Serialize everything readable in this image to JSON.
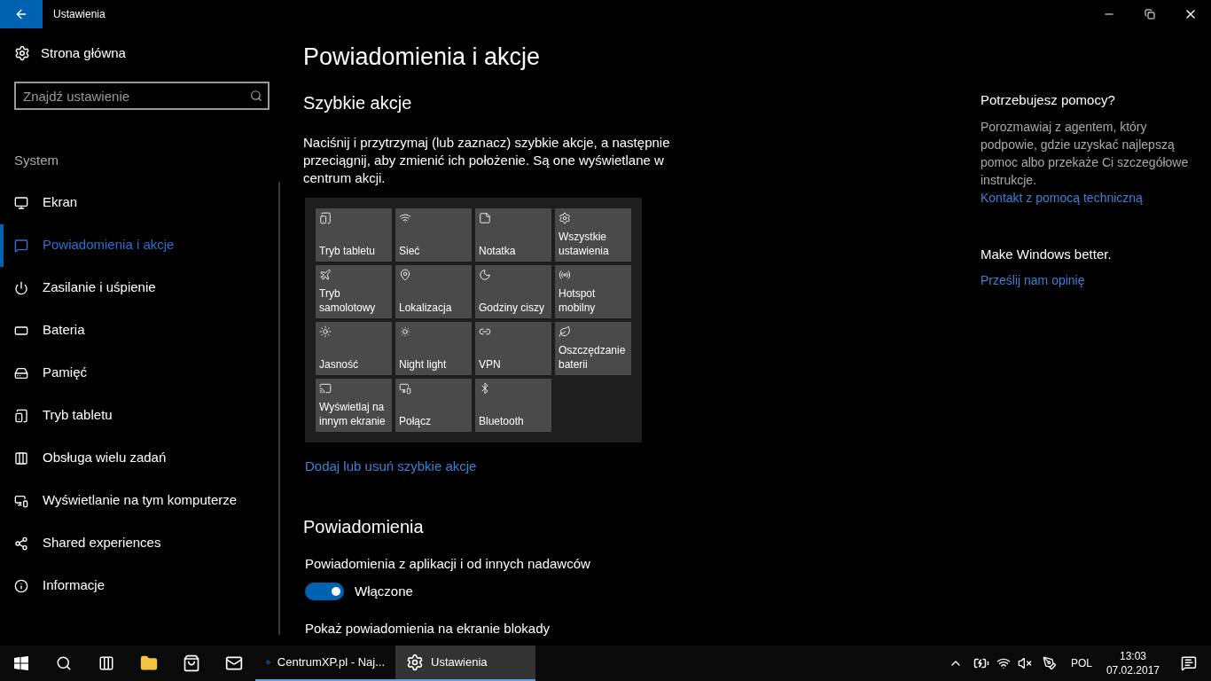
{
  "window": {
    "title": "Ustawienia"
  },
  "sidebar": {
    "home": "Strona główna",
    "search": {
      "placeholder": "Znajdź ustawienie"
    },
    "section": "System",
    "items": [
      {
        "label": "Ekran",
        "selected": false
      },
      {
        "label": "Powiadomienia i akcje",
        "selected": true
      },
      {
        "label": "Zasilanie i uśpienie",
        "selected": false
      },
      {
        "label": "Bateria",
        "selected": false
      },
      {
        "label": "Pamięć",
        "selected": false
      },
      {
        "label": "Tryb tabletu",
        "selected": false
      },
      {
        "label": "Obsługa wielu zadań",
        "selected": false
      },
      {
        "label": "Wyświetlanie na tym komputerze",
        "selected": false
      },
      {
        "label": "Shared experiences",
        "selected": false
      },
      {
        "label": "Informacje",
        "selected": false
      }
    ]
  },
  "main": {
    "title": "Powiadomienia i akcje",
    "quick_actions": {
      "heading": "Szybkie akcje",
      "description": "Naciśnij i przytrzymaj (lub zaznacz) szybkie akcje, a następnie przeciągnij, aby zmienić ich położenie. Są one wyświetlane w centrum akcji.",
      "tiles": [
        "Tryb tabletu",
        "Sieć",
        "Notatka",
        "Wszystkie ustawienia",
        "Tryb samolotowy",
        "Lokalizacja",
        "Godziny ciszy",
        "Hotspot mobilny",
        "Jasność",
        "Night light",
        "VPN",
        "Oszczędzanie baterii",
        "Wyświetlaj na innym ekranie",
        "Połącz",
        "Bluetooth"
      ],
      "link": "Dodaj lub usuń szybkie akcje"
    },
    "notifications": {
      "heading": "Powiadomienia",
      "settings": [
        {
          "label": "Powiadomienia z aplikacji i od innych nadawców",
          "on": true,
          "state": "Włączone"
        }
      ],
      "next_label": "Pokaż powiadomienia na ekranie blokady"
    }
  },
  "help": {
    "heading": "Potrzebujesz pomocy?",
    "text": "Porozmawiaj z agentem, który podpowie, gdzie uzyskać najlepszą pomoc albo przekaże Ci szczegółowe instrukcje.",
    "link": "Kontakt z pomocą techniczną",
    "feedback_heading": "Make Windows better.",
    "feedback_link": "Prześlij nam opinię"
  },
  "taskbar": {
    "apps": [
      {
        "label": "CentrumXP.pl - Naj...",
        "selected": false
      },
      {
        "label": "Ustawienia",
        "selected": true
      }
    ],
    "language": "POL",
    "time": "13:03",
    "date": "07.02.2017"
  }
}
